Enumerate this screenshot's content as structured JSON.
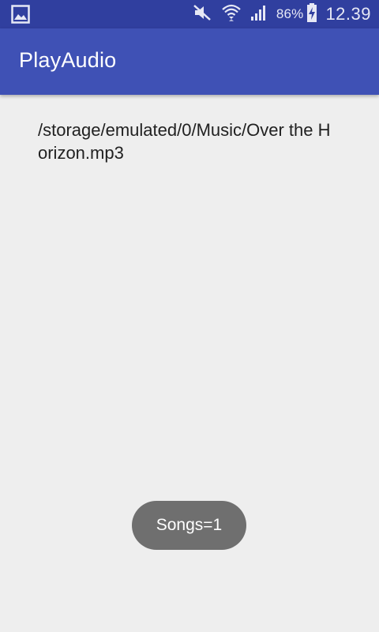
{
  "status_bar": {
    "left_icon": "image-notification-icon",
    "icons": [
      "mute-icon",
      "wifi-icon",
      "signal-icon"
    ],
    "battery_percent": "86%",
    "battery_icon": "battery-charging-icon",
    "time": "12.39",
    "color": "#303f9f"
  },
  "app_bar": {
    "title": "PlayAudio",
    "color": "#3f51b5"
  },
  "content": {
    "song_path": "/storage/emulated/0/Music/Over the Horizon.mp3"
  },
  "toast": {
    "text": "Songs=1"
  }
}
